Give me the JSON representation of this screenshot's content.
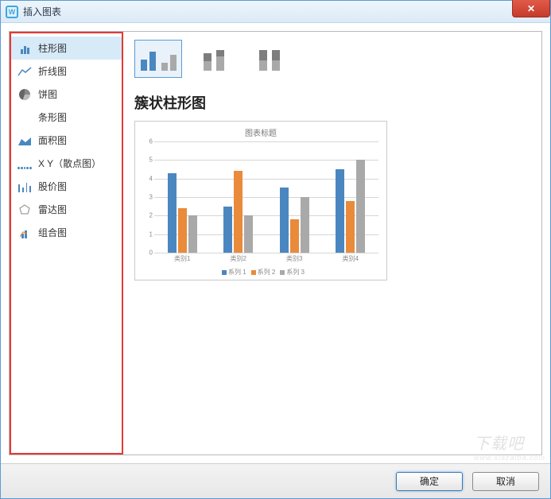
{
  "window": {
    "title": "插入图表"
  },
  "sidebar": {
    "items": [
      {
        "label": "柱形图",
        "selected": true
      },
      {
        "label": "折线图"
      },
      {
        "label": "饼图"
      },
      {
        "label": "条形图"
      },
      {
        "label": "面积图"
      },
      {
        "label": "X Y（散点图）"
      },
      {
        "label": "股价图"
      },
      {
        "label": "雷达图"
      },
      {
        "label": "组合图"
      }
    ]
  },
  "content": {
    "subtypes": [
      {
        "name": "clustered",
        "selected": true
      },
      {
        "name": "stacked"
      },
      {
        "name": "percent_stacked"
      }
    ],
    "chart_name": "簇状柱形图"
  },
  "buttons": {
    "ok": "确定",
    "cancel": "取消"
  },
  "chart_data": {
    "type": "bar",
    "title": "图表标题",
    "categories": [
      "类别1",
      "类别2",
      "类别3",
      "类别4"
    ],
    "series": [
      {
        "name": "系列 1",
        "color": "#4a87c0",
        "values": [
          4.3,
          2.5,
          3.5,
          4.5
        ]
      },
      {
        "name": "系列 2",
        "color": "#e98b3a",
        "values": [
          2.4,
          4.4,
          1.8,
          2.8
        ]
      },
      {
        "name": "系列 3",
        "color": "#a9a9a9",
        "values": [
          2.0,
          2.0,
          3.0,
          5.0
        ]
      }
    ],
    "ylim": [
      0,
      6
    ],
    "yticks": [
      0,
      1,
      2,
      3,
      4,
      5,
      6
    ],
    "xlabel": "",
    "ylabel": ""
  },
  "watermark": {
    "main": "下载吧",
    "sub": "www.xiazaiba.com"
  }
}
